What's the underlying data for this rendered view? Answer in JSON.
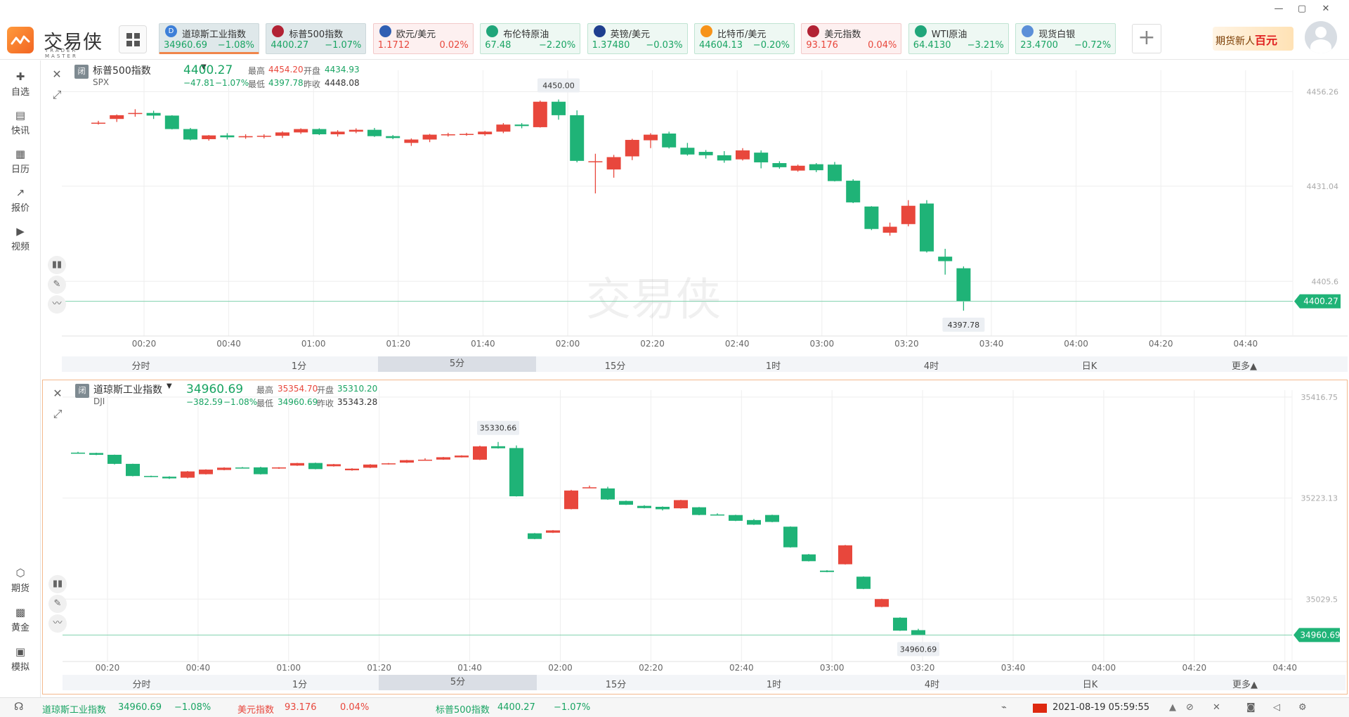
{
  "app": {
    "name": "交易侠",
    "name_en": "TRADER MASTER"
  },
  "window_controls": [
    "—",
    "▢",
    "✕"
  ],
  "tickers": [
    {
      "name": "道琼斯工业指数",
      "price": "34960.69",
      "change": "−1.08%",
      "dir": "sel",
      "icon": "D",
      "icon_color": "#3d7fd8"
    },
    {
      "name": "标普500指数",
      "price": "4400.27",
      "change": "−1.07%",
      "dir": "sel",
      "icon": "us-flag-icon",
      "icon_color": "#b22234"
    },
    {
      "name": "欧元/美元",
      "price": "1.1712",
      "change": "0.02%",
      "dir": "up",
      "icon": "eu-flag-icon",
      "icon_color": "#2f5fb3"
    },
    {
      "name": "布伦特原油",
      "price": "67.48",
      "change": "−2.20%",
      "dir": "dn",
      "icon": "oil-icon",
      "icon_color": "#1fa67a"
    },
    {
      "name": "英镑/美元",
      "price": "1.37480",
      "change": "−0.03%",
      "dir": "dn",
      "icon": "uk-flag-icon",
      "icon_color": "#1f3f8f"
    },
    {
      "name": "比特币/美元",
      "price": "44604.13",
      "change": "−0.20%",
      "dir": "dn",
      "icon": "bitcoin-icon",
      "icon_color": "#f7931a"
    },
    {
      "name": "美元指数",
      "price": "93.176",
      "change": "0.04%",
      "dir": "up",
      "icon": "us-flag-icon",
      "icon_color": "#b22234"
    },
    {
      "name": "WTI原油",
      "price": "64.4130",
      "change": "−3.21%",
      "dir": "dn",
      "icon": "oil-icon",
      "icon_color": "#1fa67a"
    },
    {
      "name": "现货白银",
      "price": "23.4700",
      "change": "−0.72%",
      "dir": "dn",
      "icon": "silver-icon",
      "icon_color": "#5b8fd8"
    }
  ],
  "promo": {
    "text_a": "期货新人",
    "text_b": "百元"
  },
  "sidebar": [
    {
      "label": "自选",
      "icon": "star-icon"
    },
    {
      "label": "快讯",
      "icon": "news-icon"
    },
    {
      "label": "日历",
      "icon": "calendar-icon"
    },
    {
      "label": "报价",
      "icon": "quote-icon"
    },
    {
      "label": "视频",
      "icon": "video-icon"
    },
    {
      "label": "期货",
      "icon": "futures-icon"
    },
    {
      "label": "黄金",
      "icon": "gold-icon"
    },
    {
      "label": "模拟",
      "icon": "simulate-icon"
    }
  ],
  "panels": [
    {
      "name": "标普500指数",
      "symbol": "SPX",
      "tag": "闭",
      "price": "4400.27",
      "change": "−47.81",
      "change_pct": "−1.07%",
      "high_label": "最高",
      "high": "4454.20",
      "open_label": "开盘",
      "open": "4434.93",
      "low_label": "最低",
      "low": "4397.78",
      "prev_label": "昨收",
      "prev": "4448.08",
      "timeframes": [
        "分时",
        "1分",
        "5分",
        "15分",
        "1时",
        "4时",
        "日K",
        "更多▲"
      ],
      "active_tf": 2
    },
    {
      "name": "道琼斯工业指数",
      "symbol": "DJI",
      "tag": "闭",
      "price": "34960.69",
      "change": "−382.59",
      "change_pct": "−1.08%",
      "high_label": "最高",
      "high": "35354.70",
      "open_label": "开盘",
      "open": "35310.20",
      "low_label": "最低",
      "low": "34960.69",
      "prev_label": "昨收",
      "prev": "35343.28",
      "timeframes": [
        "分时",
        "1分",
        "5分",
        "15分",
        "1时",
        "4时",
        "日K",
        "更多▲"
      ],
      "active_tf": 2
    }
  ],
  "chart_data": [
    {
      "type": "candlestick",
      "title": "标普500指数",
      "x_ticks": [
        "00:20",
        "00:40",
        "01:00",
        "01:20",
        "01:40",
        "02:00",
        "02:20",
        "02:40",
        "03:00",
        "03:20",
        "03:40",
        "04:00",
        "04:20",
        "04:40"
      ],
      "y_ticks": [
        4456.26,
        4431.04,
        4405.6
      ],
      "ylim": [
        4391,
        4462
      ],
      "current": 4400.27,
      "current_label": "4400.27",
      "max_label": "4450.00",
      "min_label": "4397.78",
      "colors": {
        "up": "#e8473c",
        "down": "#1fb377"
      },
      "candles": [
        [
          4448.0,
          4448.5,
          4447.5,
          4448.0
        ],
        [
          4449.0,
          4450.2,
          4448.2,
          4450.0
        ],
        [
          4450.4,
          4451.6,
          4449.6,
          4450.6
        ],
        [
          4450.6,
          4451.2,
          4449.0,
          4449.9
        ],
        [
          4449.9,
          4450.0,
          4446.2,
          4446.3
        ],
        [
          4446.3,
          4446.6,
          4443.3,
          4443.5
        ],
        [
          4443.6,
          4444.7,
          4443.2,
          4444.6
        ],
        [
          4444.6,
          4445.2,
          4443.5,
          4444.1
        ],
        [
          4444.1,
          4444.9,
          4443.7,
          4444.4
        ],
        [
          4444.4,
          4444.9,
          4443.8,
          4444.5
        ],
        [
          4444.5,
          4445.7,
          4443.9,
          4445.4
        ],
        [
          4445.4,
          4446.5,
          4445.0,
          4446.3
        ],
        [
          4446.3,
          4446.5,
          4444.7,
          4444.9
        ],
        [
          4444.9,
          4446.0,
          4444.3,
          4445.6
        ],
        [
          4445.6,
          4446.5,
          4445.2,
          4446.1
        ],
        [
          4446.1,
          4446.6,
          4444.2,
          4444.4
        ],
        [
          4444.4,
          4444.7,
          4443.6,
          4443.9
        ],
        [
          4442.6,
          4443.8,
          4441.8,
          4443.5
        ],
        [
          4443.5,
          4445.0,
          4442.8,
          4444.8
        ],
        [
          4444.7,
          4445.3,
          4444.3,
          4444.9
        ],
        [
          4444.9,
          4445.3,
          4444.5,
          4445.0
        ],
        [
          4444.9,
          4445.8,
          4444.5,
          4445.6
        ],
        [
          4445.6,
          4447.9,
          4445.2,
          4447.5
        ],
        [
          4447.5,
          4447.9,
          4446.5,
          4447.1
        ],
        [
          4446.8,
          4453.9,
          4446.7,
          4453.6
        ],
        [
          4453.6,
          4454.2,
          4448.8,
          4450.0
        ],
        [
          4450.0,
          4451.3,
          4437.4,
          4437.8
        ],
        [
          4437.6,
          4439.7,
          4429.1,
          4437.7
        ],
        [
          4435.5,
          4439.4,
          4433.3,
          4438.8
        ],
        [
          4439.0,
          4443.7,
          4438.0,
          4443.4
        ],
        [
          4443.3,
          4445.2,
          4441.2,
          4444.8
        ],
        [
          4445.1,
          4445.6,
          4441.1,
          4441.4
        ],
        [
          4441.3,
          4442.6,
          4439.2,
          4439.5
        ],
        [
          4440.2,
          4440.7,
          4438.4,
          4439.3
        ],
        [
          4439.3,
          4440.4,
          4437.3,
          4437.9
        ],
        [
          4438.2,
          4441.2,
          4437.9,
          4440.6
        ],
        [
          4440.0,
          4440.6,
          4435.8,
          4437.4
        ],
        [
          4437.2,
          4437.7,
          4435.7,
          4436.1
        ],
        [
          4435.2,
          4436.8,
          4434.9,
          4436.5
        ],
        [
          4436.9,
          4437.2,
          4434.8,
          4435.3
        ],
        [
          4436.8,
          4437.5,
          4432.3,
          4432.4
        ],
        [
          4432.5,
          4432.9,
          4426.5,
          4426.7
        ],
        [
          4425.6,
          4425.7,
          4419.3,
          4419.6
        ],
        [
          4418.6,
          4421.3,
          4417.8,
          4420.2
        ],
        [
          4420.9,
          4427.3,
          4420.3,
          4425.8
        ],
        [
          4426.4,
          4427.3,
          4413.3,
          4413.6
        ],
        [
          4412.2,
          4414.3,
          4407.4,
          4411.0
        ],
        [
          4409.1,
          4409.6,
          4397.78,
          4400.27
        ]
      ]
    },
    {
      "type": "candlestick",
      "title": "道琼斯工业指数",
      "x_ticks": [
        "00:20",
        "00:40",
        "01:00",
        "01:20",
        "01:40",
        "02:00",
        "02:20",
        "02:40",
        "03:00",
        "03:20",
        "03:40",
        "04:00",
        "04:20",
        "04:40"
      ],
      "y_ticks": [
        35416.75,
        35223.13,
        35029.5
      ],
      "ylim": [
        34910,
        35430
      ],
      "current": 34960.69,
      "current_label": "34960.69",
      "max_label": "35330.66",
      "min_label": "34960.69",
      "colors": {
        "up": "#e8473c",
        "down": "#1fb377"
      },
      "candles": [
        [
          35310.2,
          35311.8,
          35308.3,
          35309.5
        ],
        [
          35309.5,
          35310.1,
          35305.4,
          35306.1
        ],
        [
          35306.1,
          35306.4,
          35287.6,
          35288.7
        ],
        [
          35288.7,
          35289.0,
          35264.8,
          35265.4
        ],
        [
          35265.5,
          35266.1,
          35263.2,
          35263.9
        ],
        [
          35264.1,
          35265.0,
          35259.8,
          35260.9
        ],
        [
          35262.2,
          35275.0,
          35261.1,
          35274.2
        ],
        [
          35268.9,
          35278.3,
          35268.3,
          35277.7
        ],
        [
          35277.0,
          35282.2,
          35276.4,
          35281.4
        ],
        [
          35281.7,
          35282.7,
          35280.8,
          35281.3
        ],
        [
          35282.0,
          35283.1,
          35268.3,
          35268.9
        ],
        [
          35279.8,
          35282.4,
          35279.1,
          35281.9
        ],
        [
          35285.4,
          35290.7,
          35284.8,
          35290.2
        ],
        [
          35290.4,
          35291.1,
          35278.2,
          35278.7
        ],
        [
          35284.1,
          35288.6,
          35283.5,
          35288.0
        ],
        [
          35276.4,
          35280.4,
          35275.6,
          35279.5
        ],
        [
          35281.3,
          35288.2,
          35280.6,
          35287.4
        ],
        [
          35288.3,
          35290.4,
          35287.4,
          35289.7
        ],
        [
          35291.1,
          35296.4,
          35290.4,
          35295.8
        ],
        [
          35295.6,
          35299.5,
          35295.0,
          35296.7
        ],
        [
          35296.9,
          35302.0,
          35296.4,
          35301.4
        ],
        [
          35301.2,
          35305.2,
          35300.9,
          35304.6
        ],
        [
          35296.7,
          35323.6,
          35296.0,
          35322.2
        ],
        [
          35322.5,
          35330.66,
          35318.0,
          35318.6
        ],
        [
          35319.0,
          35324.0,
          35226.1,
          35226.6
        ],
        [
          35155.6,
          35156.2,
          35144.3,
          35144.8
        ],
        [
          35156.8,
          35161.8,
          35156.2,
          35161.2
        ],
        [
          35202.0,
          35238.9,
          35201.5,
          35237.6
        ],
        [
          35243.7,
          35247.1,
          35242.8,
          35243.8
        ],
        [
          35241.6,
          35244.8,
          35219.7,
          35220.5
        ],
        [
          35217.6,
          35218.3,
          35209.9,
          35210.4
        ],
        [
          35208.2,
          35209.5,
          35203.3,
          35204.0
        ],
        [
          35206.4,
          35207.2,
          35199.4,
          35201.7
        ],
        [
          35203.5,
          35219.7,
          35202.9,
          35219.2
        ],
        [
          35205.5,
          35206.1,
          35190.2,
          35190.8
        ],
        [
          35191.7,
          35193.9,
          35190.6,
          35191.1
        ],
        [
          35190.6,
          35191.2,
          35179.0,
          35179.6
        ],
        [
          35181.0,
          35183.0,
          35171.6,
          35172.2
        ],
        [
          35190.7,
          35191.3,
          35176.8,
          35177.4
        ],
        [
          35168.3,
          35168.9,
          35128.2,
          35128.8
        ],
        [
          35115.2,
          35116.0,
          35101.7,
          35102.2
        ],
        [
          35084.1,
          35085.0,
          35081.0,
          35081.5
        ],
        [
          35096.3,
          35133.3,
          35095.7,
          35132.6
        ],
        [
          35072.5,
          35073.0,
          35048.6,
          35049.1
        ],
        [
          35014.6,
          35030.2,
          35014.0,
          35029.6
        ],
        [
          34993.9,
          34994.6,
          34968.6,
          34969.1
        ],
        [
          34970.0,
          34972.6,
          34960.69,
          34960.69
        ]
      ]
    }
  ],
  "status_bar": [
    {
      "name": "道琼斯工业指数",
      "price": "34960.69",
      "change": "−1.08%",
      "dir": "dn"
    },
    {
      "name": "美元指数",
      "price": "93.176",
      "change": "0.04%",
      "dir": "up"
    },
    {
      "name": "标普500指数",
      "price": "4400.27",
      "change": "−1.07%",
      "dir": "dn"
    }
  ],
  "datetime": "2021-08-19 05:59:55"
}
